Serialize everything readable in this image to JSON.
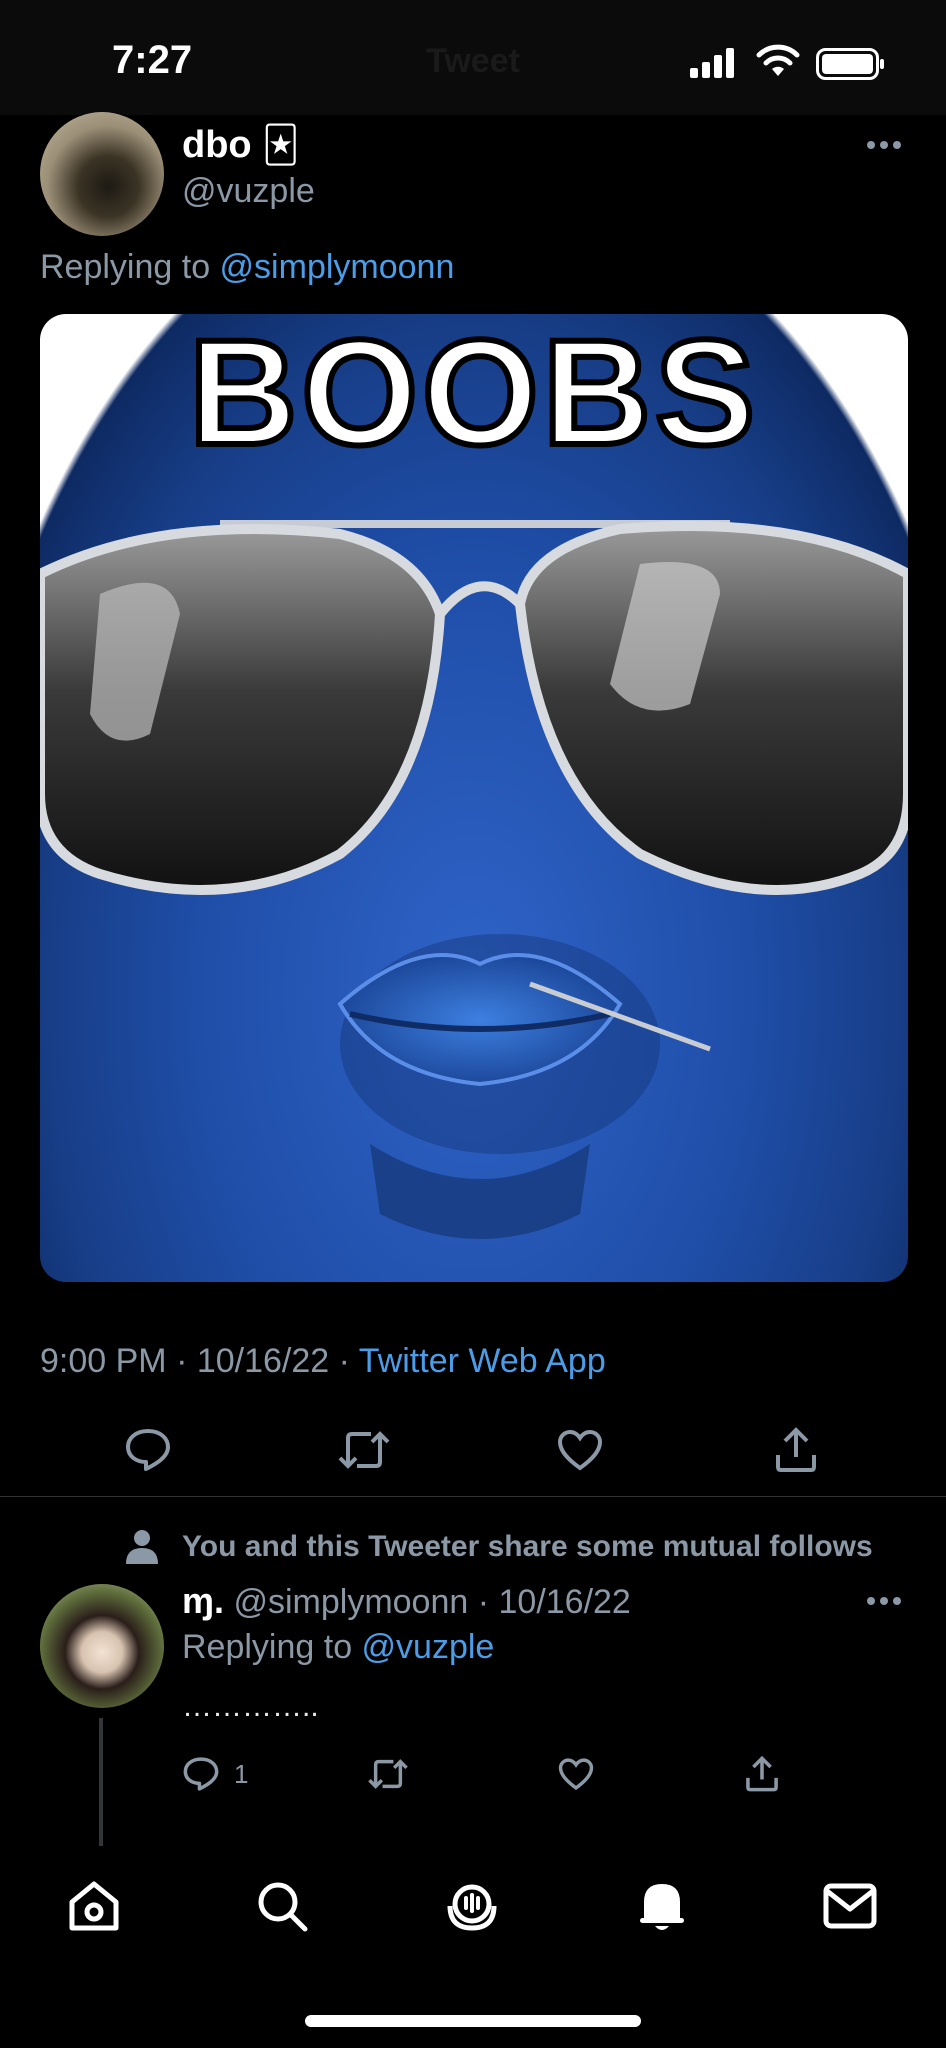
{
  "status_bar": {
    "time": "7:27",
    "title": "Tweet"
  },
  "main_tweet": {
    "display_name": "dbo",
    "name_emoji": "🃏",
    "handle": "@vuzple",
    "more_icon": "more-horizontal-icon",
    "replying_prefix": "Replying to ",
    "replying_handle": "@simplymoonn",
    "image_text": "BOOBS",
    "timestamp": "9:00 PM · 10/16/22 · ",
    "source": "Twitter Web App",
    "actions": [
      "reply-icon",
      "retweet-icon",
      "like-icon",
      "share-icon"
    ]
  },
  "reply": {
    "mutual_notice": "You and this Tweeter share some mutual follows",
    "display_name": "ɱ.",
    "handle_date": "@simplymoonn · 10/16/22",
    "replying_prefix": "Replying to ",
    "replying_handle": "@vuzple",
    "text": "…………..",
    "reply_count": "1"
  },
  "tab_bar": {
    "items": [
      "home-icon",
      "search-icon",
      "spaces-icon",
      "notifications-icon",
      "messages-icon"
    ]
  },
  "colors": {
    "background": "#000000",
    "link": "#4c9de8",
    "muted": "#8b98a5",
    "icon": "#8b98a5"
  }
}
